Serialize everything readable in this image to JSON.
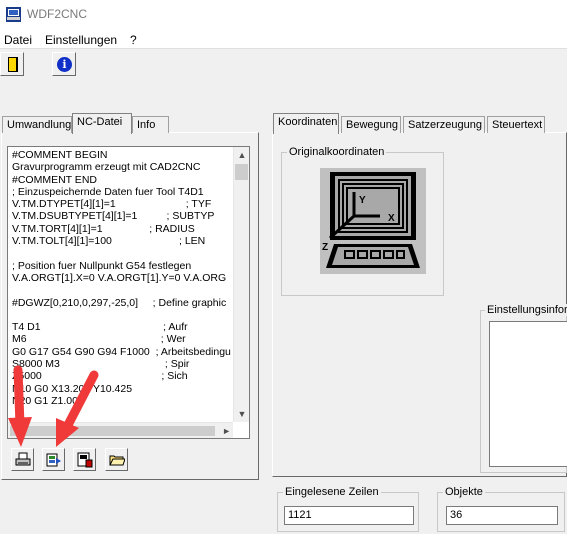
{
  "window": {
    "title": "WDF2CNC"
  },
  "menu": [
    "Datei",
    "Einstellungen",
    "?"
  ],
  "toolbar": {
    "buttons": [
      "exit-icon",
      "info-icon"
    ]
  },
  "left_tabs": [
    "Umwandlung",
    "NC-Datei",
    "Info"
  ],
  "left_active_tab": "NC-Datei",
  "editor": {
    "lines": [
      "#COMMENT BEGIN",
      "Gravurprogramm erzeugt mit CAD2CNC",
      "#COMMENT END",
      "; Einzuspeichernde Daten fuer Tool T4D1",
      "V.TM.DTYPET[4][1]=1                        ; TYF",
      "V.TM.DSUBTYPET[4][1]=1          ; SUBTYP",
      "V.TM.TORT[4][1]=1                ; RADIUS",
      "V.TM.TOLT[4][1]=100                       ; LEN",
      "",
      "; Position fuer Nullpunkt G54 festlegen",
      "V.A.ORGT[1].X=0 V.A.ORGT[1].Y=0 V.A.ORG",
      "",
      "#DGWZ[0,210,0,297,-25,0]     ; Define graphic",
      "",
      "T4 D1                                          ; Aufr",
      "M6                                              ; Wer",
      "G0 G17 G54 G90 G94 F1000  ; Arbeitsbedingu",
      "S8000 M3                                    ; Spir",
      "Z5000                                         ; Sich",
      "N10 G0 X13.205 Y10.425",
      "N20 G1 Z1.000"
    ]
  },
  "editor_buttons": [
    "print-icon",
    "convert-icon",
    "save-icon",
    "open-folder-icon"
  ],
  "right_tabs": [
    "Koordinaten",
    "Bewegung",
    "Satzerzeugung",
    "Steuertext"
  ],
  "right_active_tab": "Koordinaten",
  "groups": {
    "original_coords": "Originalkoordinaten",
    "settings_info": "Einstellungsinform",
    "lines_read": "Eingelesene Zeilen",
    "objects": "Objekte"
  },
  "values": {
    "lines_read": "1121",
    "objects": "36"
  },
  "diagram": {
    "axis_x": "X",
    "axis_y": "Y",
    "axis_z": "Z"
  },
  "colors": {
    "arrow": "#f03a3a",
    "info_blue": "#1030c8",
    "exit_yellow": "#ffd800"
  }
}
